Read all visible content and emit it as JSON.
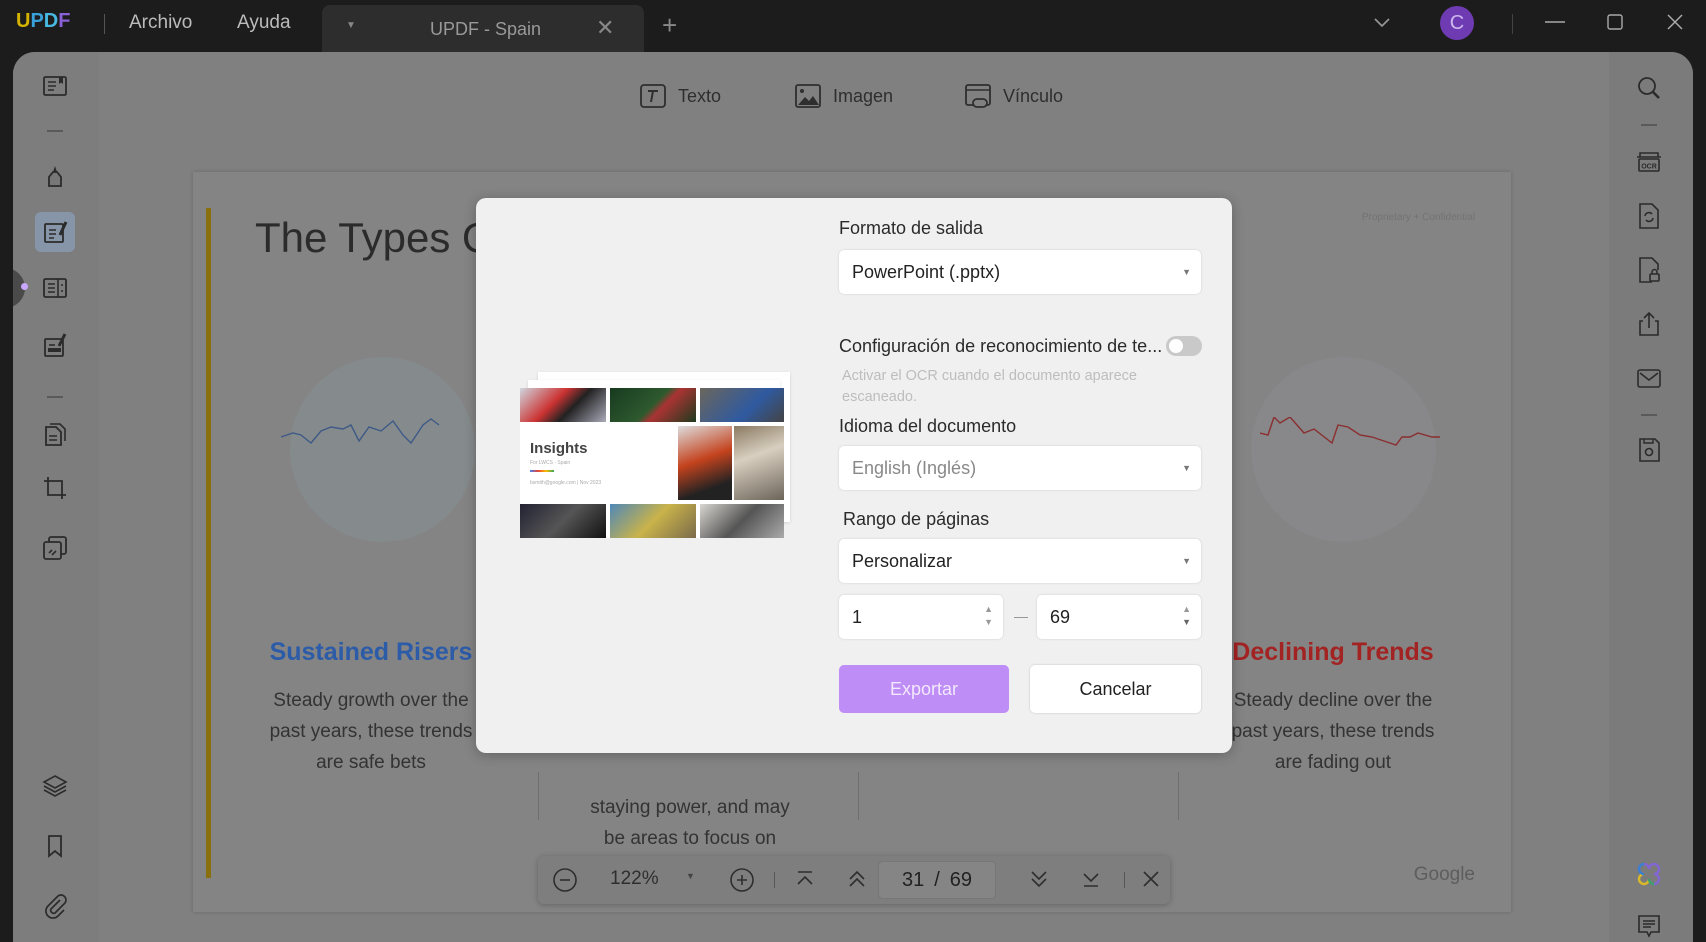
{
  "titlebar": {
    "logo": "UPDF",
    "menus": [
      "Archivo",
      "Ayuda"
    ],
    "tab_title": "UPDF - Spain",
    "avatar_initial": "C"
  },
  "edit_toolbar": {
    "items": [
      {
        "label": "Texto",
        "icon": "text-box-icon"
      },
      {
        "label": "Imagen",
        "icon": "image-icon"
      },
      {
        "label": "Vínculo",
        "icon": "link-icon"
      }
    ]
  },
  "left_sidebar": {
    "items": [
      "reader-icon",
      "comment-highlighter-icon",
      "edit-pdf-icon",
      "organize-pages-icon",
      "fill-sign-icon",
      "convert-pdf-icon",
      "crop-icon",
      "compress-icon"
    ],
    "bottom": [
      "layers-icon",
      "bookmark-icon",
      "attachment-icon"
    ]
  },
  "right_sidebar": {
    "items": [
      "search-icon",
      "ocr-icon",
      "convert-icon",
      "protect-icon",
      "share-icon",
      "email-icon",
      "save-icon"
    ],
    "bottom": [
      "updf-ai-icon",
      "comments-icon"
    ]
  },
  "document": {
    "title": "The Types O",
    "proprietary": "Proprietary + Confidential",
    "columns": [
      {
        "title": "Sustained Risers",
        "color": "#2c5ba8",
        "text": [
          "Steady growth over the",
          "past years, these trends",
          "are safe bets"
        ]
      },
      {
        "title": "",
        "text": [
          "staying power, and may",
          "be areas to focus on"
        ]
      },
      {
        "title": "Declining Trends",
        "color": "#a32222",
        "text": [
          "Steady decline over the",
          "past years, these trends",
          "are fading out"
        ]
      }
    ],
    "footer_brand": "Google"
  },
  "bottom_toolbar": {
    "zoom": "122%",
    "current_page": "31",
    "separator": "/",
    "total_pages": "69"
  },
  "dialog": {
    "output_format_label": "Formato de salida",
    "output_format_value": "PowerPoint (.pptx)",
    "ocr_label": "Configuración de reconocimiento de te...",
    "ocr_enabled": false,
    "ocr_hint": "Activar el OCR cuando el documento aparece escaneado.",
    "language_label": "Idioma del documento",
    "language_value": "English (Inglés)",
    "range_label": "Rango de páginas",
    "range_value": "Personalizar",
    "range_from": "1",
    "range_to": "69",
    "export_label": "Exportar",
    "cancel_label": "Cancelar",
    "preview": {
      "title": "Insights",
      "subtitle": "For LWCS - Spain",
      "byline": "bsmith@google.com | Nov 2023"
    },
    "accent_color": "#be8df5"
  }
}
